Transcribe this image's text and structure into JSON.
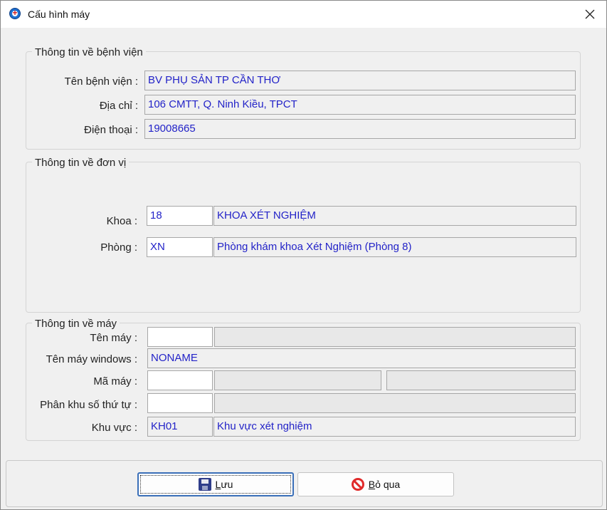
{
  "window": {
    "title": "Cấu hình máy"
  },
  "hospital": {
    "group_title": "Thông tin về bệnh viện",
    "name_label": "Tên bệnh viện :",
    "name_value": "BV PHỤ SẢN TP CẦN THƠ",
    "address_label": "Địa chỉ :",
    "address_value": "106 CMTT, Q. Ninh Kiều, TPCT",
    "phone_label": "Điện thoại :",
    "phone_value": "19008665"
  },
  "unit": {
    "group_title": "Thông tin về đơn vị",
    "dept_label": "Khoa :",
    "dept_code": "18",
    "dept_name": "KHOA XÉT NGHIỆM",
    "room_label": "Phòng :",
    "room_code": "XN",
    "room_name": "Phòng khám khoa Xét Nghiệm (Phòng 8)"
  },
  "machine": {
    "group_title": "Thông tin về máy",
    "name_label": "Tên máy :",
    "name_code": "",
    "name_desc": "",
    "windows_label": "Tên máy windows :",
    "windows_value": "NONAME",
    "code_label": "Mã máy :",
    "code_value": "",
    "code_extra1": "",
    "code_extra2": "",
    "queue_label": "Phân khu số thứ tự :",
    "queue_code": "",
    "queue_desc": "",
    "area_label": "Khu vực :",
    "area_code": "KH01",
    "area_name": "Khu vực xét nghiệm"
  },
  "buttons": {
    "save_prefix": "L",
    "save_rest": "ưu",
    "cancel_prefix": "B",
    "cancel_rest": "ỏ qua"
  },
  "icons": {
    "app": "hospital-icon",
    "close": "close-icon",
    "save": "floppy-disk-icon",
    "cancel": "no-entry-icon"
  }
}
